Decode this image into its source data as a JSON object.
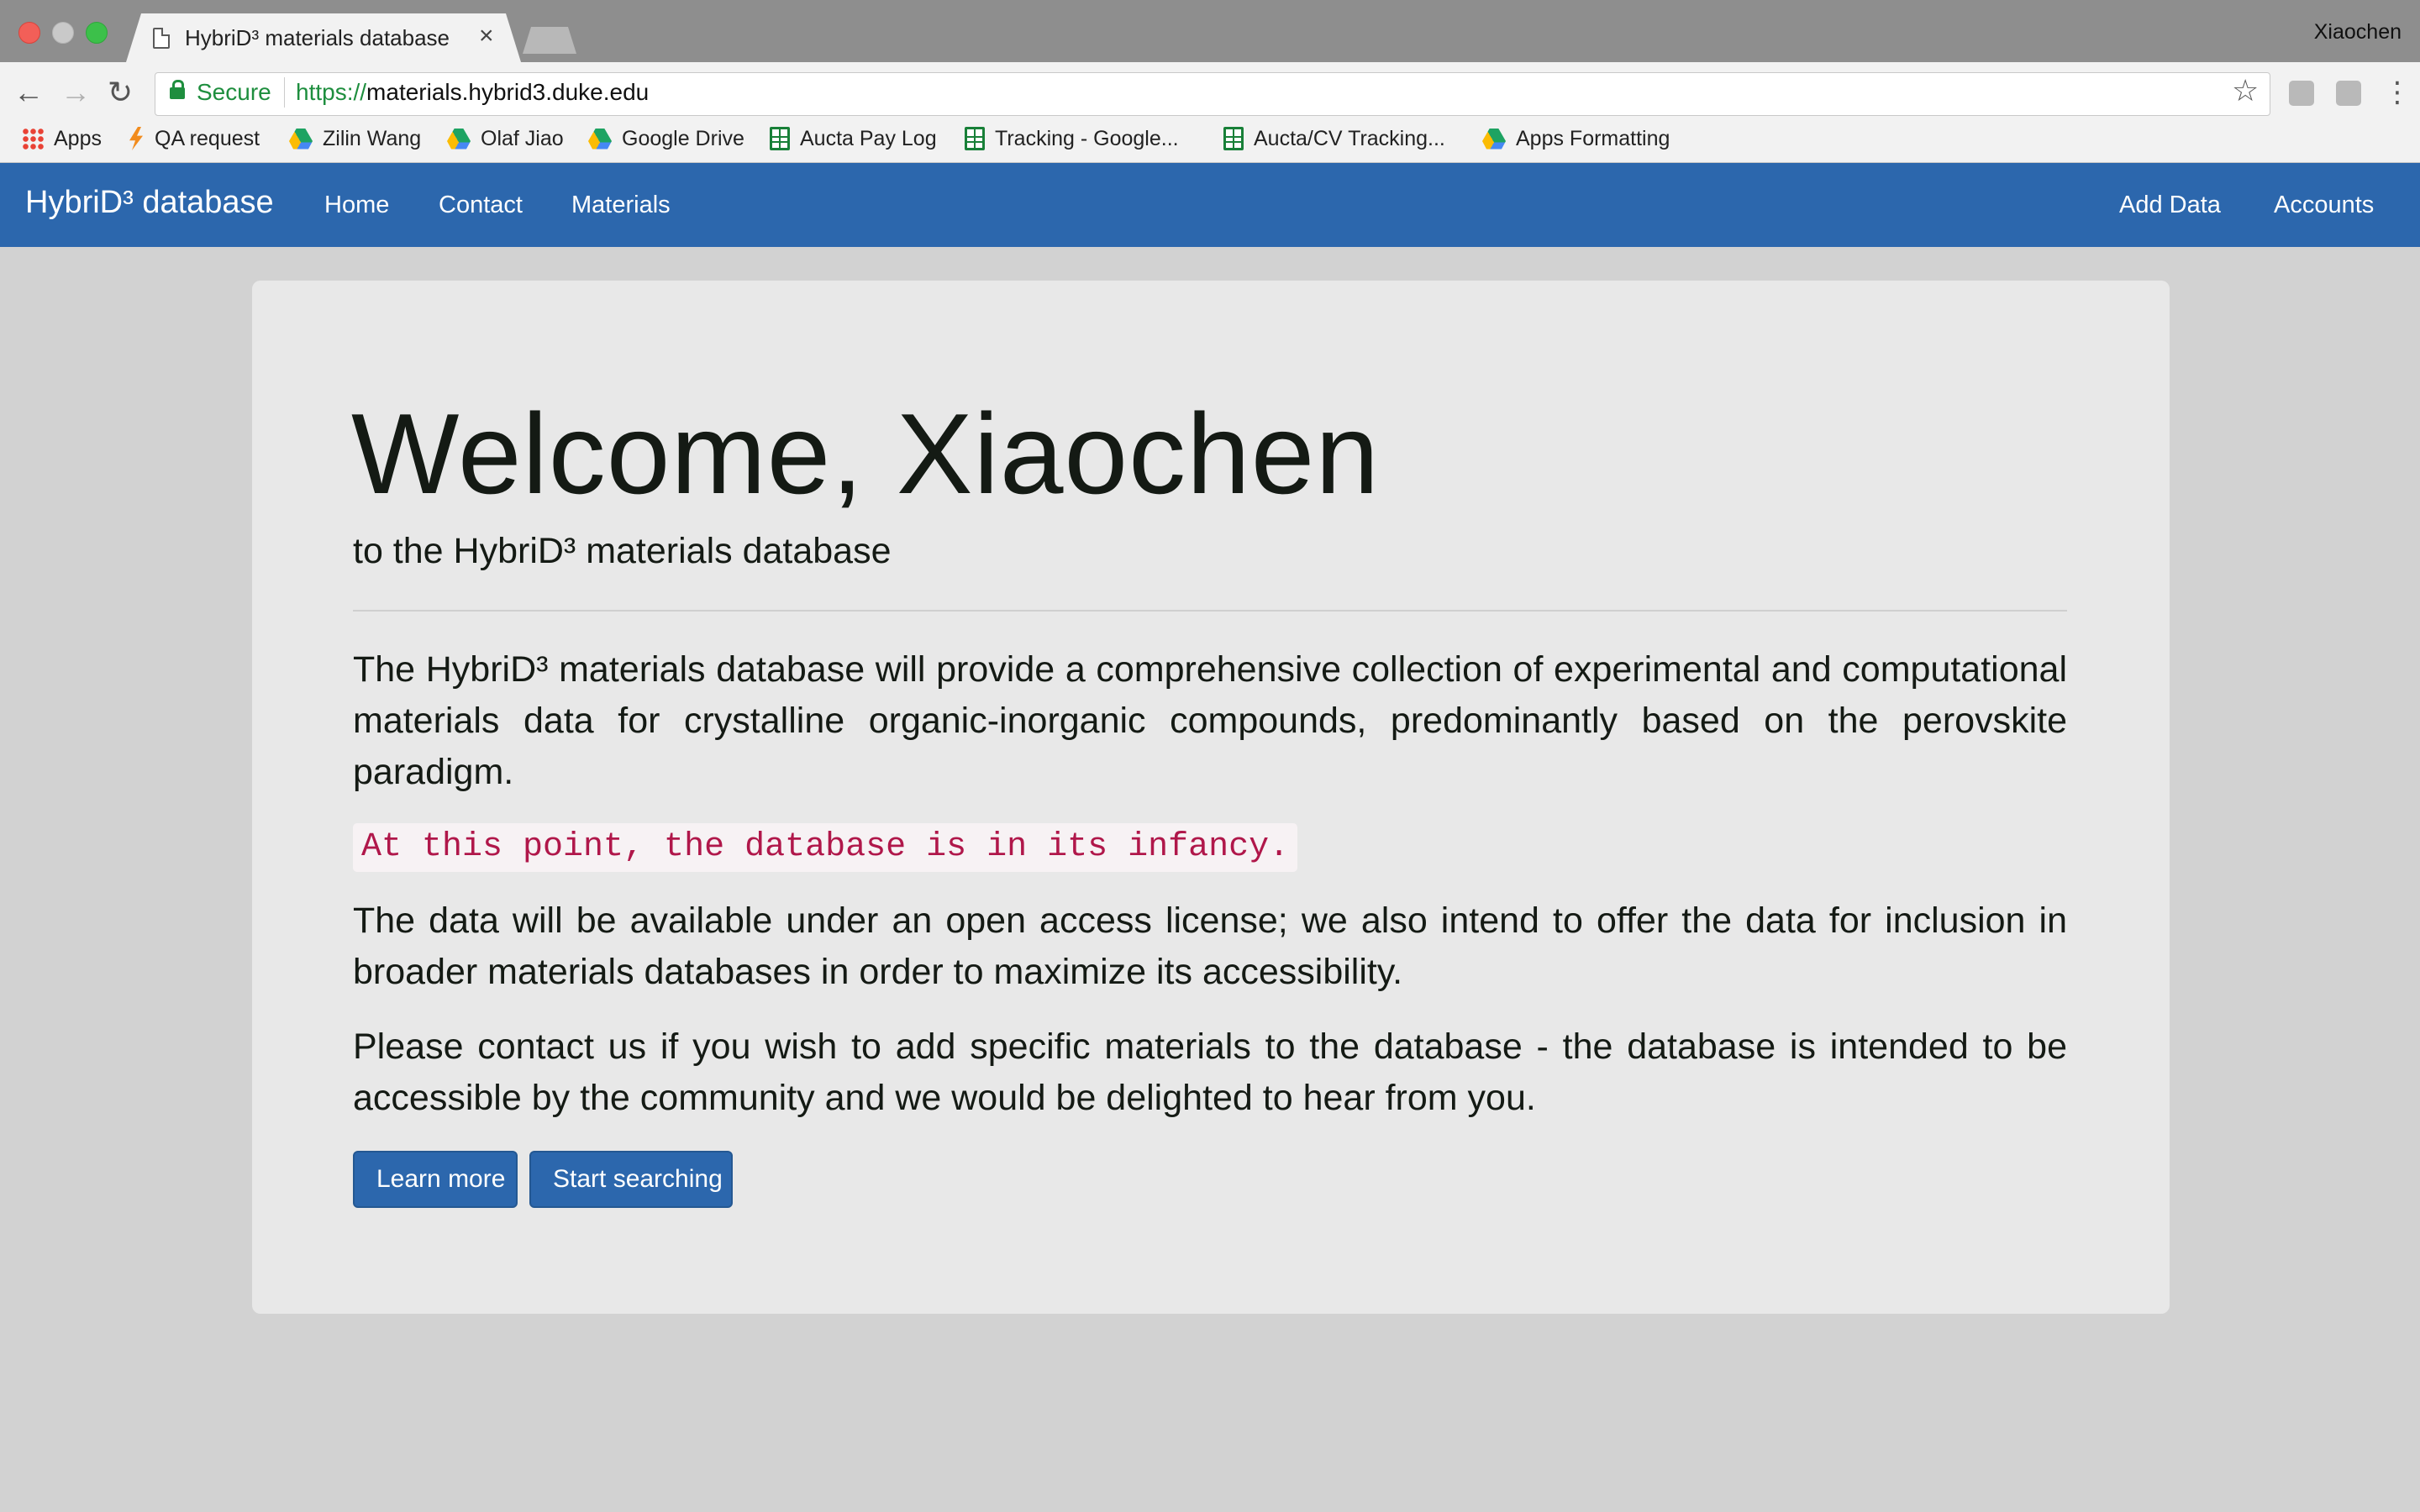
{
  "browser": {
    "tab_title": "HybriD³ materials database",
    "tab_close": "×",
    "profile_name": "Xiaochen",
    "security_label": "Secure",
    "url_scheme": "https://",
    "url_host": "materials.hybrid3.duke.edu",
    "bookmarks": [
      {
        "label": "Apps",
        "icon": "apps-grid-icon"
      },
      {
        "label": "QA request",
        "icon": "bolt-icon"
      },
      {
        "label": "Zilin Wang",
        "icon": "google-drive-icon"
      },
      {
        "label": "Olaf Jiao",
        "icon": "google-drive-icon"
      },
      {
        "label": "Google Drive",
        "icon": "google-drive-icon"
      },
      {
        "label": "Aucta Pay Log",
        "icon": "google-sheets-icon"
      },
      {
        "label": "Tracking - Google...",
        "icon": "google-sheets-icon"
      },
      {
        "label": "Aucta/CV Tracking...",
        "icon": "google-sheets-icon"
      },
      {
        "label": "Apps Formatting",
        "icon": "google-drive-icon"
      }
    ]
  },
  "site_nav": {
    "brand": "HybriD³ database",
    "links": [
      "Home",
      "Contact",
      "Materials"
    ],
    "right_links": [
      "Add Data",
      "Accounts"
    ],
    "color": "#2c67ad"
  },
  "hero": {
    "heading": "Welcome, Xiaochen",
    "subtitle": "to the HybriD³ materials database",
    "paragraph1": "The HybriD³ materials database will provide a comprehensive collection of experimental and computational materials data for crystalline organic-inorganic compounds, predominantly based on the perovskite paradigm.",
    "notice": "At this point, the database is in its infancy.",
    "paragraph2": "The data will be available under an open access license; we also intend to offer the data for inclusion in broader materials databases in order to maximize its accessibility.",
    "paragraph3": "Please contact us if you wish to add specific materials to the database - the database is intended to be accessible by the community and we would be delighted to hear from you.",
    "buttons": {
      "learn_more": "Learn more",
      "start_searching": "Start searching"
    }
  }
}
